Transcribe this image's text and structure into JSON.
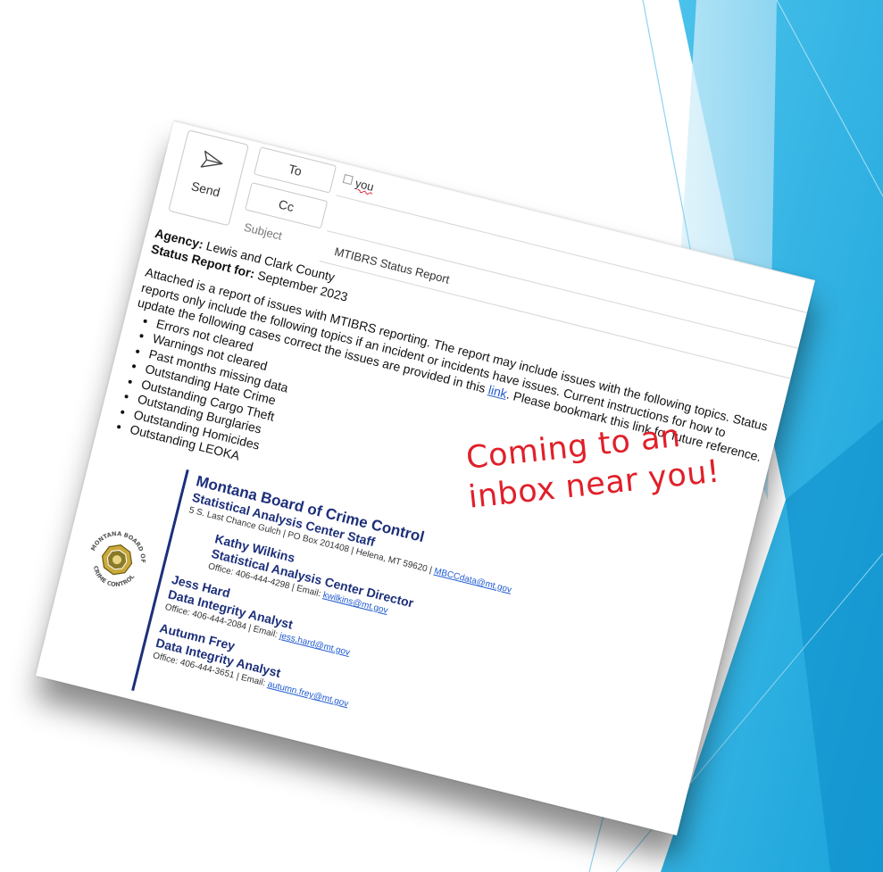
{
  "compose": {
    "send_label": "Send",
    "to_label": "To",
    "cc_label": "Cc",
    "subject_label": "Subject",
    "to_value": "you",
    "subject_value": "MTIBRS Status Report"
  },
  "body": {
    "agency_label": "Agency:",
    "agency_value": "Lewis and Clark County",
    "period_label": "Status Report for:",
    "period_value": "September 2023",
    "intro_a": "Attached is a report of issues with MTIBRS reporting.  The report may include issues with the following topics.  Status reports only include the following topics if an incident or incidents have issues. Current instructions for how to update the following cases correct the issues are provided in this ",
    "link_text": "link",
    "intro_b": ".  Please bookmark this link for future reference.",
    "topics": [
      "Errors not cleared",
      "Warnings not cleared",
      "Past months missing data",
      "Outstanding Hate Crime",
      "Outstanding Cargo Theft",
      "Outstanding Burglaries",
      "Outstanding Homicides",
      "Outstanding LEOKA"
    ]
  },
  "signature": {
    "seal_text": "MONTANA BOARD OF CRIME CONTROL",
    "org": "Montana Board of Crime Control",
    "staff": "Statistical Analysis Center Staff",
    "address": "5 S. Last Chance Gulch | PO Box 201408 | Helena, MT 59620 | ",
    "address_email": "MBCCdata@mt.gov",
    "people": [
      {
        "name": "Kathy Wilkins",
        "title": "Statistical Analysis Center Director",
        "office": "Office: 406-444-4298 | Email: ",
        "email": "kwilkins@mt.gov"
      },
      {
        "name": "Jess Hard",
        "title": "Data Integrity Analyst",
        "office": "Office: 406-444-2084 | Email: ",
        "email": "jess.hard@mt.gov"
      },
      {
        "name": "Autumn Frey",
        "title": "Data Integrity Analyst",
        "office": "Office: 406-444-3651 | Email: ",
        "email": "autumn.frey@mt.gov"
      }
    ]
  },
  "annotation": {
    "line1": "Coming to an",
    "line2": "inbox near you!"
  },
  "colors": {
    "accent_blue": "#29b8e8",
    "signature_navy": "#1c2f7a",
    "annotation_red": "#e0202a",
    "link_blue": "#1f5bd1"
  }
}
